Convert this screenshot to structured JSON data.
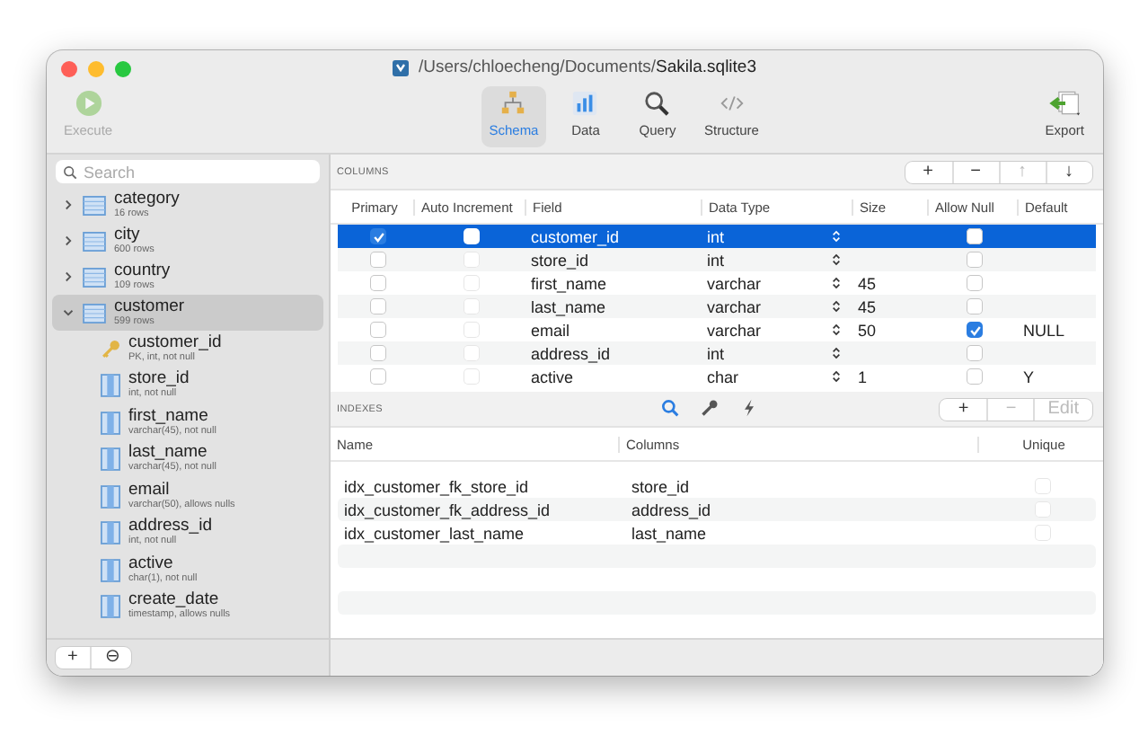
{
  "window": {
    "title": "/Users/chloecheng/Documents/**Sakila.sqlite3**"
  },
  "toolbar": {
    "execute": {
      "label": "Execute",
      "disabled": true
    },
    "views": [
      {
        "label": "Schema",
        "kind": "schema",
        "selected": true
      },
      {
        "label": "Data",
        "kind": "data",
        "selected": false
      },
      {
        "label": "Query",
        "kind": "query",
        "selected": false
      },
      {
        "label": "Structure",
        "kind": "structure",
        "selected": false
      }
    ],
    "export": {
      "label": "Export"
    }
  },
  "sidebar": {
    "search": {
      "placeholder": "Search"
    },
    "items": [
      {
        "name": "category",
        "detail": "16 rows",
        "expanded": false,
        "selected": false
      },
      {
        "name": "city",
        "detail": "600 rows",
        "expanded": false,
        "selected": false
      },
      {
        "name": "country",
        "detail": "109 rows",
        "expanded": false,
        "selected": false
      },
      {
        "name": "customer",
        "detail": "599 rows",
        "expanded": true,
        "selected": true,
        "children": [
          {
            "name": "customer_id",
            "detail": "PK, int, not null",
            "kind": "key"
          },
          {
            "name": "store_id",
            "detail": "int, not null",
            "kind": "column"
          },
          {
            "name": "first_name",
            "detail": "varchar(45), not null",
            "kind": "column"
          },
          {
            "name": "last_name",
            "detail": "varchar(45), not null",
            "kind": "column"
          },
          {
            "name": "email",
            "detail": "varchar(50), allows nulls",
            "kind": "column"
          },
          {
            "name": "address_id",
            "detail": "int, not null",
            "kind": "column"
          },
          {
            "name": "active",
            "detail": "char(1), not null",
            "kind": "column"
          },
          {
            "name": "create_date",
            "detail": "timestamp, allows nulls",
            "kind": "column"
          }
        ]
      }
    ],
    "buttons": [
      {
        "label": "+"
      },
      {
        "label": "⊖"
      }
    ]
  },
  "columns": {
    "title": "COLUMNS",
    "buttons": [
      {
        "label": "+",
        "disabled": false
      },
      {
        "label": "−",
        "disabled": false
      },
      {
        "label": "↑",
        "disabled": true
      },
      {
        "label": "↓",
        "disabled": false
      }
    ],
    "headers": [
      "Primary",
      "Auto Increment",
      "Field",
      "Data Type",
      "Size",
      "Allow Null",
      "Default"
    ],
    "rows": [
      {
        "primary": true,
        "auto_increment": false,
        "field": "customer_id",
        "type": "int",
        "allow_null": false,
        "selected": true
      },
      {
        "primary": false,
        "auto_increment": false,
        "field": "store_id",
        "type": "int",
        "allow_null": false,
        "selected": false
      },
      {
        "primary": false,
        "auto_increment": false,
        "field": "first_name",
        "type": "varchar",
        "size": "45",
        "allow_null": false,
        "selected": false
      },
      {
        "primary": false,
        "auto_increment": false,
        "field": "last_name",
        "type": "varchar",
        "size": "45",
        "allow_null": false,
        "selected": false
      },
      {
        "primary": false,
        "auto_increment": false,
        "field": "email",
        "type": "varchar",
        "size": "50",
        "allow_null": true,
        "default": "NULL",
        "selected": false
      },
      {
        "primary": false,
        "auto_increment": false,
        "field": "address_id",
        "type": "int",
        "allow_null": false,
        "selected": false
      },
      {
        "primary": false,
        "auto_increment": false,
        "field": "active",
        "type": "char",
        "size": "1",
        "allow_null": false,
        "default": "Y",
        "selected": false
      }
    ]
  },
  "indexes": {
    "title": "INDEXES",
    "tabs": [
      {
        "kind": "search",
        "selected": true
      },
      {
        "kind": "key",
        "selected": false
      },
      {
        "kind": "bolt",
        "selected": false
      }
    ],
    "buttons": [
      {
        "label": "+",
        "disabled": false
      },
      {
        "label": "−",
        "disabled": true
      },
      {
        "label": "Edit",
        "disabled": true
      }
    ],
    "headers": [
      "Name",
      "Columns",
      "Unique"
    ],
    "rows": [
      {
        "name": "idx_customer_fk_store_id",
        "columns": "store_id",
        "unique": false
      },
      {
        "name": "idx_customer_fk_address_id",
        "columns": "address_id",
        "unique": false
      },
      {
        "name": "idx_customer_last_name",
        "columns": "last_name",
        "unique": false
      }
    ]
  }
}
